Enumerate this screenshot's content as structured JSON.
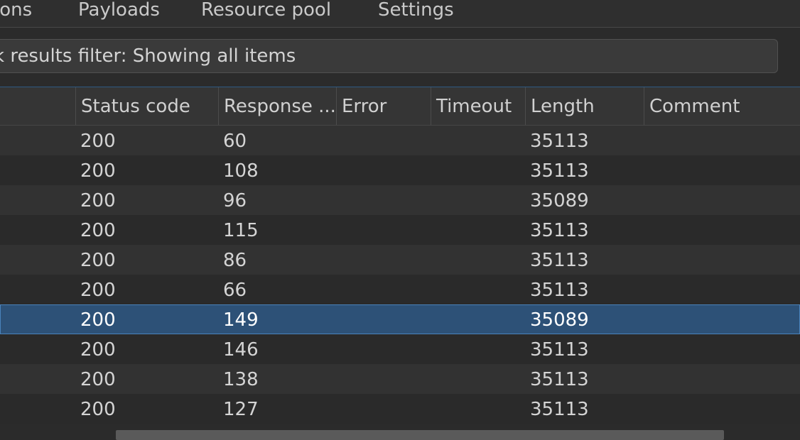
{
  "tabs": [
    {
      "label": "ions"
    },
    {
      "label": "Payloads"
    },
    {
      "label": "Resource pool"
    },
    {
      "label": "Settings"
    }
  ],
  "filter": {
    "text": "k results filter: Showing all items"
  },
  "table": {
    "columns": [
      "",
      "Status code",
      "Response ...",
      "Error",
      "Timeout",
      "Length",
      "Comment"
    ],
    "rows": [
      {
        "status": "200",
        "response": "60",
        "error": "",
        "timeout": "",
        "length": "35113",
        "comment": ""
      },
      {
        "status": "200",
        "response": "108",
        "error": "",
        "timeout": "",
        "length": "35113",
        "comment": ""
      },
      {
        "status": "200",
        "response": "96",
        "error": "",
        "timeout": "",
        "length": "35089",
        "comment": ""
      },
      {
        "status": "200",
        "response": "115",
        "error": "",
        "timeout": "",
        "length": "35113",
        "comment": ""
      },
      {
        "status": "200",
        "response": "86",
        "error": "",
        "timeout": "",
        "length": "35113",
        "comment": ""
      },
      {
        "status": "200",
        "response": "66",
        "error": "",
        "timeout": "",
        "length": "35113",
        "comment": ""
      },
      {
        "status": "200",
        "response": "149",
        "error": "",
        "timeout": "",
        "length": "35089",
        "comment": "",
        "selected": true
      },
      {
        "status": "200",
        "response": "146",
        "error": "",
        "timeout": "",
        "length": "35113",
        "comment": ""
      },
      {
        "status": "200",
        "response": "138",
        "error": "",
        "timeout": "",
        "length": "35113",
        "comment": ""
      },
      {
        "status": "200",
        "response": "127",
        "error": "",
        "timeout": "",
        "length": "35113",
        "comment": ""
      }
    ]
  },
  "colors": {
    "background": "#2b2b2b",
    "header": "#353535",
    "selected_row": "#2d5177",
    "selected_border": "#4a82bb",
    "accent_line": "#2f5a83"
  }
}
